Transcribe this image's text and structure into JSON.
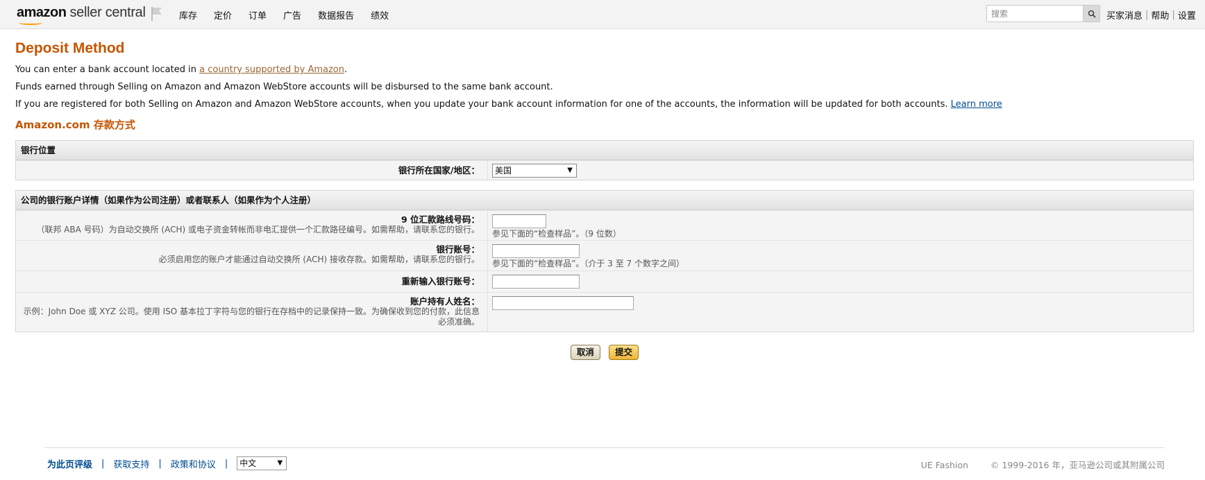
{
  "header": {
    "logo_amazon": "amazon",
    "logo_sellercentral": "seller central",
    "nav": [
      "库存",
      "定价",
      "订单",
      "广告",
      "数据报告",
      "绩效"
    ],
    "search_placeholder": "搜索",
    "links": [
      "买家消息",
      "帮助",
      "设置"
    ]
  },
  "page": {
    "title": "Deposit Method",
    "para1_before": "You can enter a bank account located in ",
    "para1_link": "a country supported by Amazon",
    "para1_after": ".",
    "para2": "Funds earned through Selling on Amazon and Amazon WebStore accounts will be disbursed to the same bank account.",
    "para3": "If you are registered for both Selling on Amazon and Amazon WebStore accounts, when you update your bank account information for one of the accounts, the information will be updated for both accounts. ",
    "para3_link": "Learn more ",
    "subtitle": "Amazon.com 存款方式"
  },
  "bank_location": {
    "heading": "银行位置",
    "country_label": "银行所在国家/地区：",
    "country_value": "美国"
  },
  "account": {
    "heading": "公司的银行账户详情（如果作为公司注册）或者联系人（如果作为个人注册）",
    "routing": {
      "label": "9 位汇款路线号码：",
      "help": "（联邦 ABA 号码）为自动交换所 (ACH) 或电子资金转帐而非电汇提供一个汇款路径编号。如需帮助，请联系您的银行。",
      "hint": "参见下面的“检查样品”。（9 位数）"
    },
    "account_no": {
      "label": "银行账号：",
      "help": "必须启用您的账户才能通过自动交换所 (ACH) 接收存款。如需帮助，请联系您的银行。",
      "hint": "参见下面的“检查样品”。（介于 3 至 7 个数字之间）"
    },
    "reenter": {
      "label": "重新输入银行账号："
    },
    "holder": {
      "label": "账户持有人姓名：",
      "help": "示例：John Doe 或 XYZ 公司。使用 ISO 基本拉丁字符与您的银行在存档中的记录保持一致。为确保收到您的付款，此信息必须准确。"
    }
  },
  "actions": {
    "cancel": "取消",
    "submit": "提交"
  },
  "footer": {
    "rate": "为此页评级",
    "support": "获取支持",
    "policy": "政策和协议",
    "language": "中文",
    "ue": "UE Fashion",
    "copyright": "© 1999-2016 年，亚马逊公司或其附属公司"
  }
}
